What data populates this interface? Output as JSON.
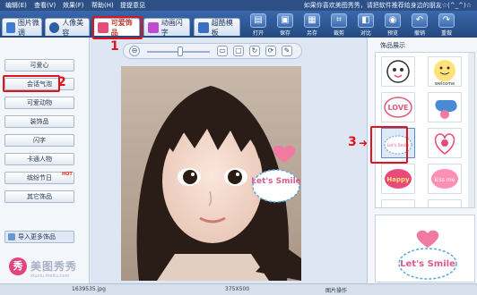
{
  "menubar": {
    "items": [
      "编辑(E)",
      "查看(V)",
      "效果(F)",
      "帮助(H)",
      "提提意见"
    ],
    "slogan": "如果你喜欢美图秀秀，请把软件推荐给身边的朋友☆(^_^)☆"
  },
  "tabs": [
    {
      "label": "图片微调",
      "active": false,
      "icon_color": "#3d7bd0"
    },
    {
      "label": "人像美容",
      "active": false,
      "icon_color": "#2c5fa8"
    },
    {
      "label": "可爱饰品",
      "active": true,
      "icon_color": "#e84a7a"
    },
    {
      "label": "动画闪字",
      "active": false,
      "icon_color": "#c04ad0"
    },
    {
      "label": "超酷模板",
      "active": false,
      "icon_color": "#3a6fc4"
    }
  ],
  "toolbar": [
    {
      "label": "打开",
      "icon": "folder-icon",
      "glyph": "▤"
    },
    {
      "label": "保存",
      "icon": "save-icon",
      "glyph": "▣"
    },
    {
      "label": "另存",
      "icon": "save-as-icon",
      "glyph": "▦"
    },
    {
      "label": "裁剪",
      "icon": "crop-icon",
      "glyph": "⌗"
    },
    {
      "label": "对比",
      "icon": "compare-icon",
      "glyph": "◧"
    },
    {
      "label": "预览",
      "icon": "preview-icon",
      "glyph": "◉"
    },
    {
      "label": "撤销",
      "icon": "undo-icon",
      "glyph": "↶"
    },
    {
      "label": "重做",
      "icon": "redo-icon",
      "glyph": "↷"
    }
  ],
  "left_buttons": [
    "可爱心",
    "会话气泡",
    "可爱动物",
    "装饰品",
    "闪字",
    "卡通人物",
    "缤纷节日",
    "其它饰品"
  ],
  "hot_badge": "HOT",
  "import_label": "导入更多饰品",
  "brand": {
    "name": "美图秀秀",
    "url": "xiuxiu.meitu.com",
    "logo_char": "秀"
  },
  "zoom": {
    "out_glyph": "🔍",
    "level": 0.55
  },
  "right_panel": {
    "title": "饰品展示",
    "items": [
      {
        "text": "",
        "color": "#e84a7a"
      },
      {
        "text": "welcome",
        "color": "#d8b020"
      },
      {
        "text": "LOVE",
        "color": "#e05a7a"
      },
      {
        "text": "",
        "color": "#3a6fc4"
      },
      {
        "text": "Let's Smile",
        "color": "#5aa6e0"
      },
      {
        "text": "",
        "color": "#e84a7a"
      },
      {
        "text": "Happy",
        "color": "#e84a7a"
      },
      {
        "text": "kiss me",
        "color": "#e84a7a"
      },
      {
        "text": "",
        "color": "#8a6aa8"
      },
      {
        "text": "",
        "color": "#e84a7a"
      }
    ],
    "preview_text": "Let's Smile"
  },
  "sticker_text": "Let's Smile",
  "statusbar": {
    "filename": "1639535.jpg",
    "size": "375X500",
    "mode": "图片操作"
  },
  "annotations": {
    "step1": "1",
    "step2": "2",
    "step3": "3"
  }
}
